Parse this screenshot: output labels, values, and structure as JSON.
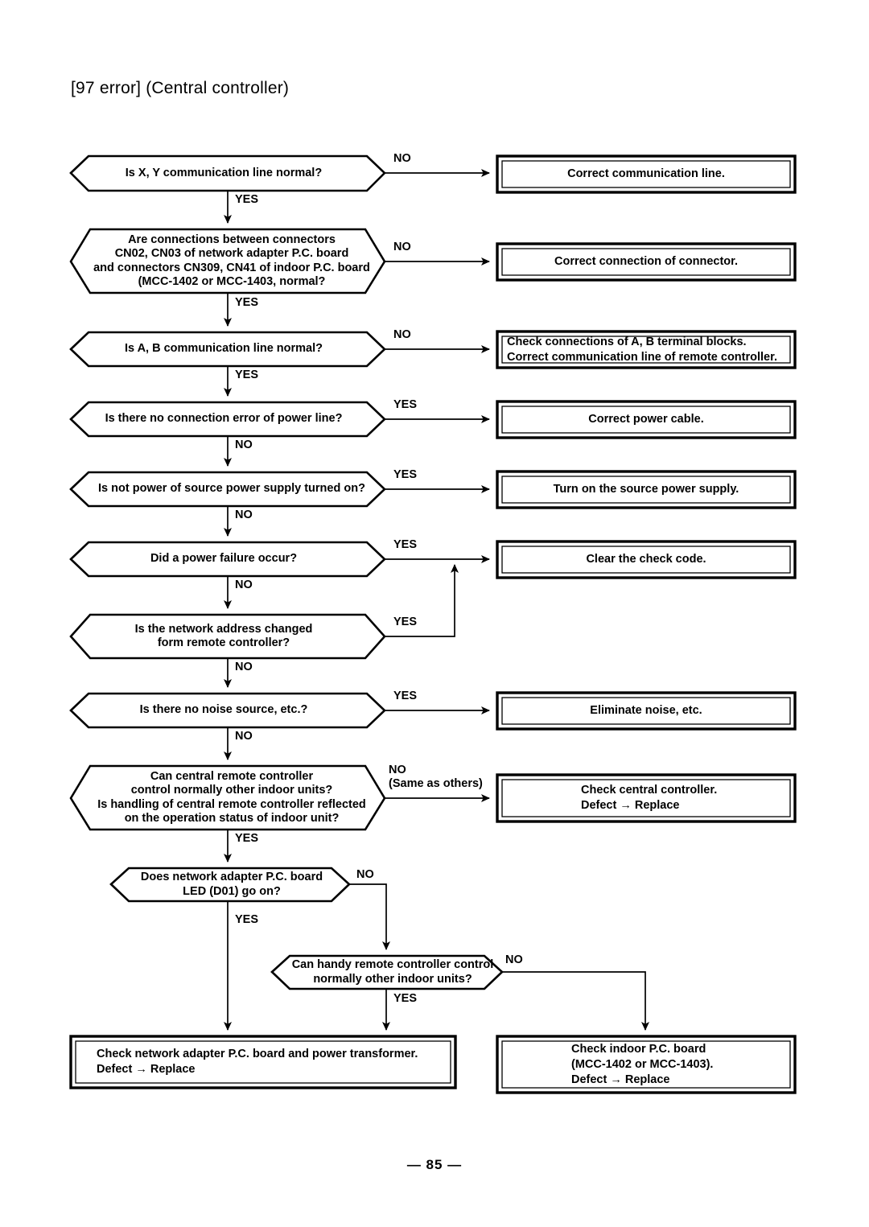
{
  "document": {
    "title": "[97 error] (Central controller)",
    "page_number": "— 85 —"
  },
  "flowchart": {
    "decisions": [
      {
        "id": "xy-comm-line",
        "lines": [
          "Is X, Y communication line normal?"
        ],
        "yes_label": "YES",
        "no_label": "NO"
      },
      {
        "id": "connector-connections",
        "lines": [
          "Are connections between connectors",
          "CN02, CN03 of network adapter P.C. board",
          "and connectors CN309, CN41 of indoor P.C. board",
          "(MCC-1402 or MCC-1403, normal?"
        ],
        "yes_label": "YES",
        "no_label": "NO"
      },
      {
        "id": "ab-comm-line",
        "lines": [
          "Is A, B communication line normal?"
        ],
        "yes_label": "YES",
        "no_label": "NO"
      },
      {
        "id": "power-line-error",
        "lines": [
          "Is there no connection error of power line?"
        ],
        "yes_label": "YES",
        "no_label": "NO"
      },
      {
        "id": "source-power-supply",
        "lines": [
          "Is not power of source power supply turned on?"
        ],
        "yes_label": "YES",
        "no_label": "NO"
      },
      {
        "id": "power-failure",
        "lines": [
          "Did a power failure occur?"
        ],
        "yes_label": "YES",
        "no_label": "NO"
      },
      {
        "id": "network-address-changed",
        "lines": [
          "Is the network address changed",
          "form remote controller?"
        ],
        "yes_label": "YES",
        "no_label": "NO"
      },
      {
        "id": "noise-source",
        "lines": [
          "Is there no noise source, etc.?"
        ],
        "yes_label": "YES",
        "no_label": "NO"
      },
      {
        "id": "central-remote-controller",
        "lines": [
          "Can central remote controller",
          "control normally other indoor units?",
          "Is handling of central remote controller reflected",
          "on the operation status of indoor unit?"
        ],
        "yes_label": "YES",
        "no_label": "NO",
        "no_label_2": "(Same as others)"
      },
      {
        "id": "network-adapter-led",
        "lines": [
          "Does network adapter P.C. board",
          "LED (D01) go on?"
        ],
        "yes_label": "YES",
        "no_label": "NO"
      },
      {
        "id": "handy-remote-controller",
        "lines": [
          "Can handy remote controller control",
          "normally other indoor units?"
        ],
        "yes_label": "YES",
        "no_label": "NO"
      }
    ],
    "actions": [
      {
        "id": "correct-communication-line",
        "lines": [
          "Correct communication line."
        ]
      },
      {
        "id": "correct-connection-of-connector",
        "lines": [
          "Correct connection of connector."
        ]
      },
      {
        "id": "check-ab-terminal-blocks",
        "lines": [
          "Check connections of A, B terminal blocks.",
          "Correct communication line of remote controller."
        ]
      },
      {
        "id": "correct-power-cable",
        "lines": [
          "Correct power cable."
        ]
      },
      {
        "id": "turn-on-source-power-supply",
        "lines": [
          "Turn on the source power supply."
        ]
      },
      {
        "id": "clear-the-check-code",
        "lines": [
          "Clear the check code."
        ]
      },
      {
        "id": "eliminate-noise",
        "lines": [
          "Eliminate noise, etc."
        ]
      },
      {
        "id": "check-central-controller",
        "lines": [
          "Check central controller.",
          "Defect → Replace"
        ]
      },
      {
        "id": "check-network-adapter",
        "lines": [
          "Check network adapter P.C. board and power transformer.",
          "Defect → Replace"
        ]
      },
      {
        "id": "check-indoor-pc-board",
        "lines": [
          "Check indoor P.C. board",
          "(MCC-1402 or MCC-1403).",
          "Defect → Replace"
        ]
      }
    ]
  }
}
